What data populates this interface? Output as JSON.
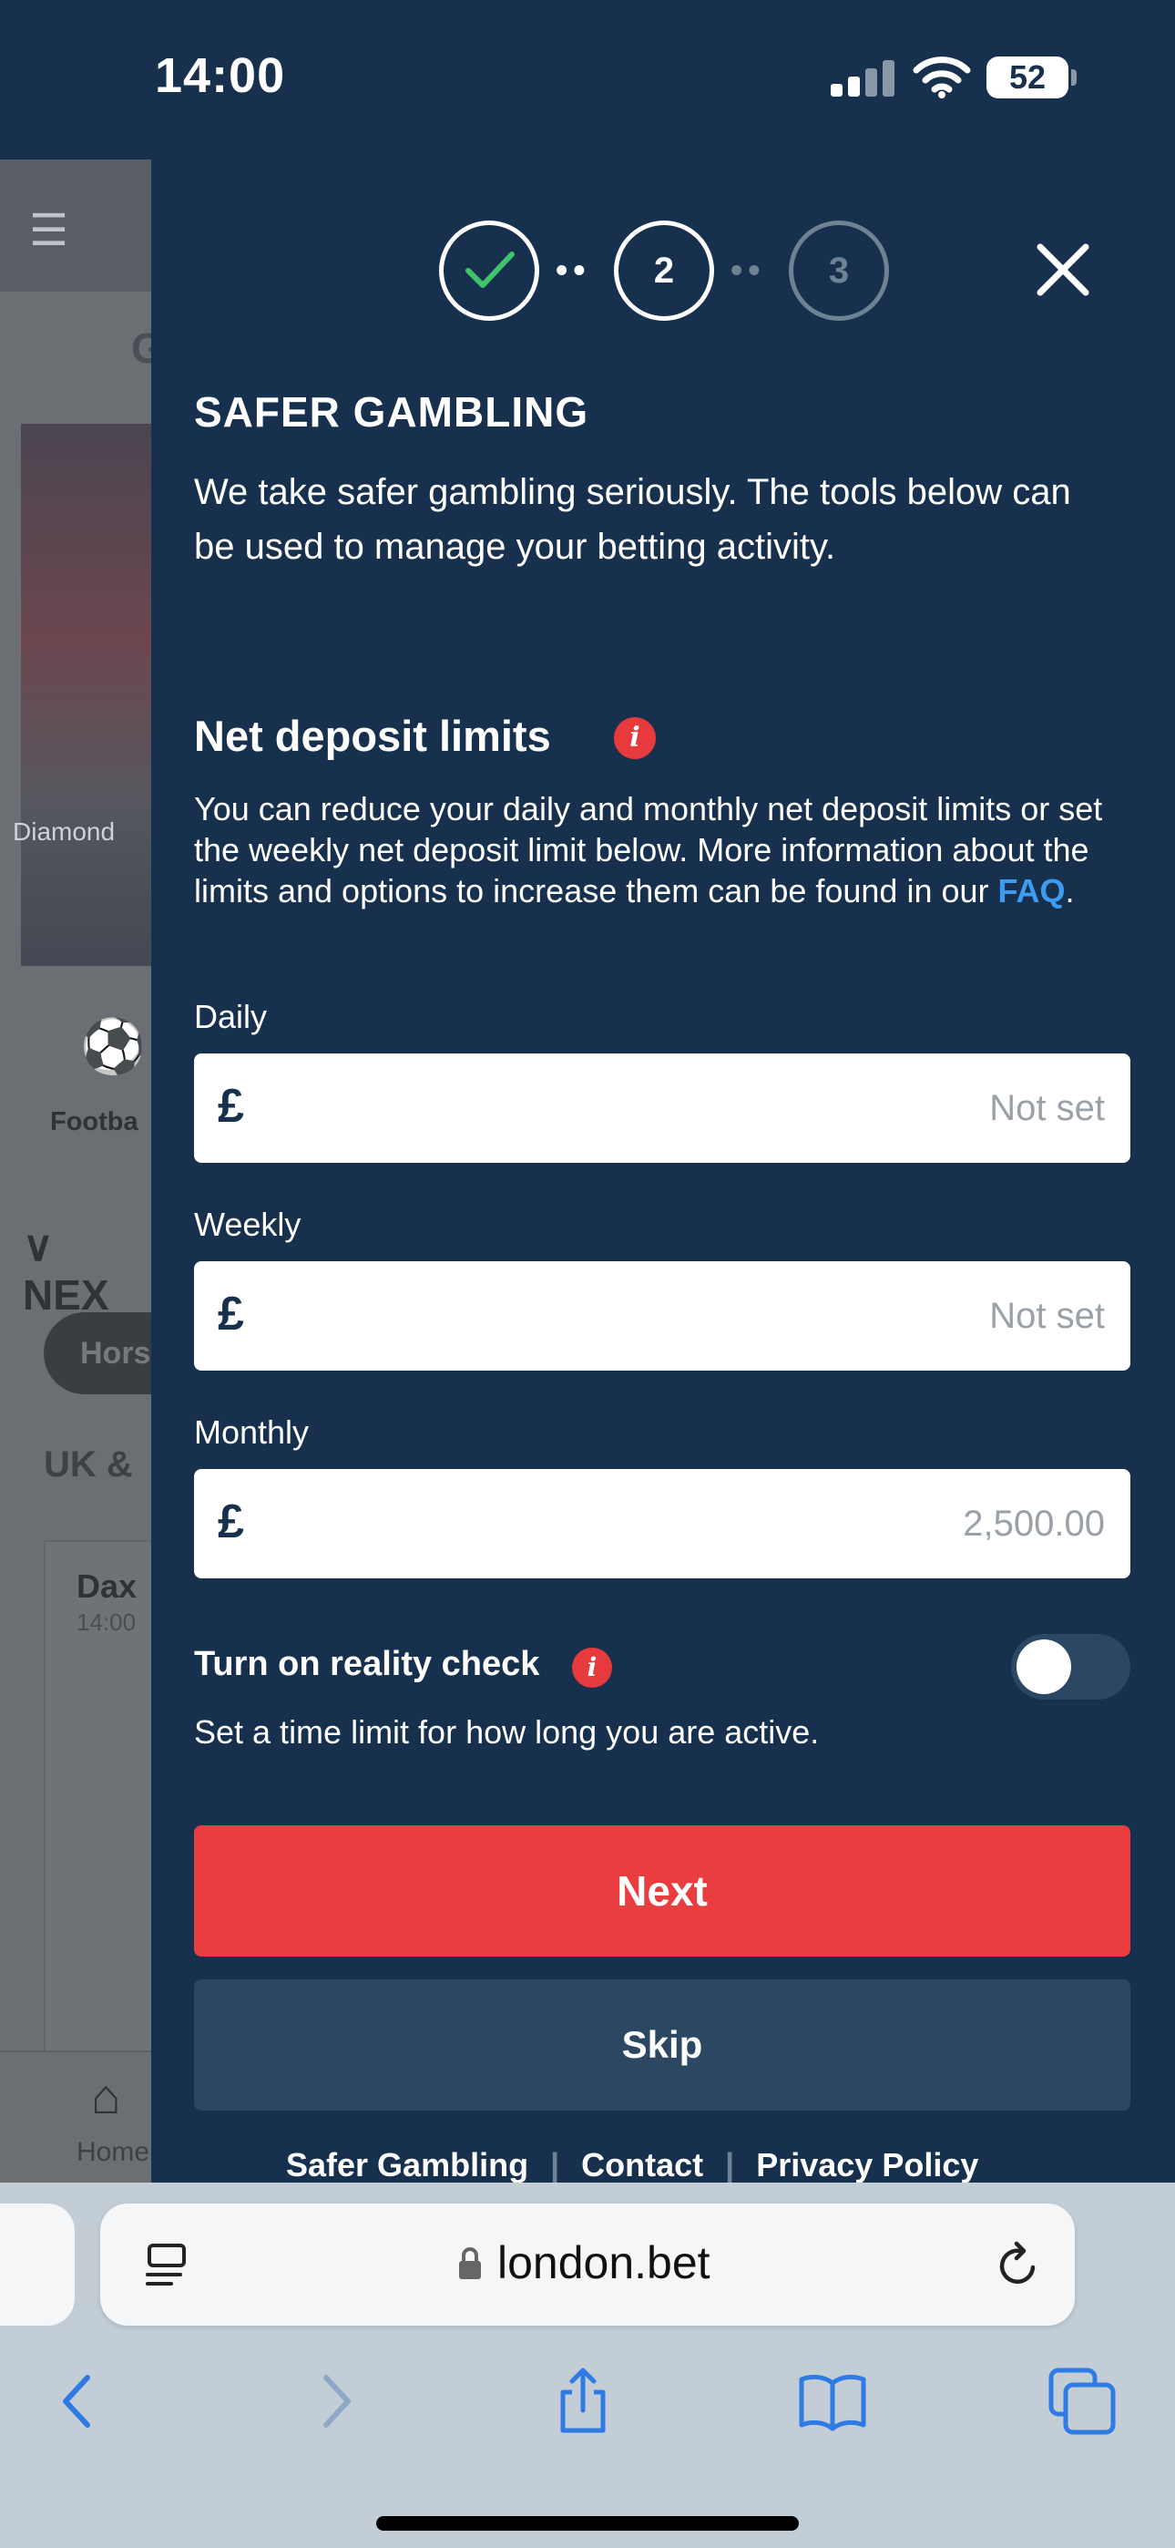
{
  "status_bar": {
    "time": "14:00",
    "battery": "52"
  },
  "background_page": {
    "diamond": "Diamond",
    "football": "Footba",
    "next": "NEX",
    "pill": "Hors",
    "uk": "UK &",
    "dax": "Dax",
    "dax_time": "14:00",
    "home": "Home",
    "g": "G"
  },
  "steps": {
    "step2": "2",
    "step3": "3"
  },
  "modal": {
    "title": "SAFER GAMBLING",
    "intro": "We take safer gambling seriously. The tools below can be used to manage your betting activity.",
    "net_deposit_title": "Net deposit limits",
    "description_before": "You can reduce your daily and monthly net deposit limits or set the weekly net deposit limit below. More information about the limits and options to increase them can be found in our ",
    "faq_link": "FAQ",
    "description_after": ".",
    "currency": "£",
    "daily_label": "Daily",
    "daily_placeholder": "Not set",
    "weekly_label": "Weekly",
    "weekly_placeholder": "Not set",
    "monthly_label": "Monthly",
    "monthly_placeholder": "2,500.00",
    "reality_check_label": "Turn on reality check",
    "reality_check_on": false,
    "reality_check_desc": "Set a time limit for how long you are active.",
    "next_button": "Next",
    "skip_button": "Skip",
    "footer_links": [
      "Safer Gambling",
      "Contact",
      "Privacy Policy"
    ]
  },
  "browser": {
    "url": "london.bet"
  },
  "colors": {
    "panel": "#16304d",
    "accent_red": "#ea3d3f",
    "link_blue": "#3d9cf0",
    "check_green": "#3fc46a",
    "skip_bg": "#2b4762"
  }
}
